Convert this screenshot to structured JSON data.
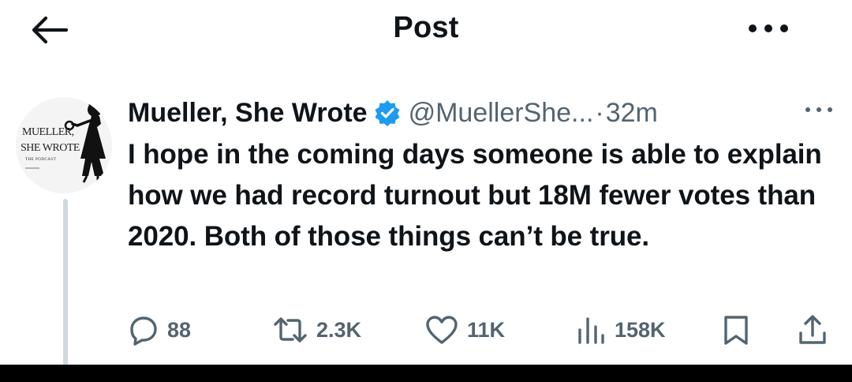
{
  "header": {
    "title": "Post",
    "back_icon": "arrow-left-icon",
    "more_icon": "more-horizontal-icon"
  },
  "post": {
    "author": {
      "display_name": "Mueller, She Wrote",
      "verified": true,
      "handle": "@MuellerShe...",
      "avatar_logo_lines": [
        "MUELLER,",
        "SHE WROTE",
        "THE PODCAST"
      ]
    },
    "separator": "·",
    "time": "32m",
    "text": "I hope in the coming days someone is able to explain how we had record turnout but 18M fewer votes than 2020. Both of those things can’t be true.",
    "actions": {
      "replies": "88",
      "reposts": "2.3K",
      "likes": "11K",
      "views": "158K"
    }
  },
  "colors": {
    "text": "#0f1419",
    "secondary": "#536471",
    "verified_blue": "#1d9bf0",
    "thread_line": "#cfd9de"
  }
}
